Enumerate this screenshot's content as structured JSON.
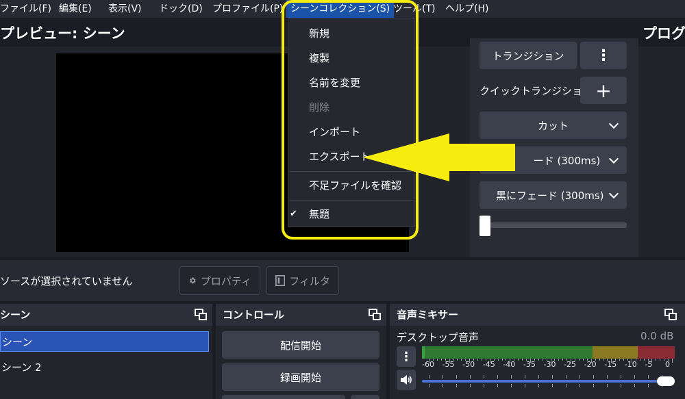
{
  "menubar": {
    "items": [
      {
        "label": "ファイル(F)"
      },
      {
        "label": "編集(E)"
      },
      {
        "label": "表示(V)"
      },
      {
        "label": "ドック(D)"
      },
      {
        "label": "プロファイル(P)"
      },
      {
        "label": "シーンコレクション(S)"
      },
      {
        "label": "ツール(T)"
      },
      {
        "label": "ヘルプ(H)"
      }
    ]
  },
  "preview": {
    "title": "プレビュー: シーン"
  },
  "program": {
    "title": "プログ"
  },
  "scene_collection_menu": {
    "items": [
      {
        "label": "新規"
      },
      {
        "label": "複製"
      },
      {
        "label": "名前を変更"
      },
      {
        "label": "削除",
        "disabled": true
      },
      {
        "label": "インポート"
      },
      {
        "label": "エクスポート"
      },
      {
        "label": "不足ファイルを確認"
      },
      {
        "label": "無題",
        "checked": true
      }
    ],
    "check_mark": "✔"
  },
  "transitions": {
    "transition_button": "トランジション",
    "more_glyph": "⋮",
    "quick_transition_label": "クイックトランジション",
    "add_glyph": "+",
    "cut": "カット",
    "fade": "フェード (300ms)",
    "fade_partial": "ード (300ms)",
    "fade_to_black": "黒にフェード (300ms)"
  },
  "source_bar": {
    "no_source": "ソースが選択されていません",
    "properties": "プロパティ",
    "filters": "フィルタ"
  },
  "scenes": {
    "title": "シーン",
    "items": [
      {
        "label": "シーン",
        "selected": true
      },
      {
        "label": "シーン 2"
      }
    ]
  },
  "controls": {
    "title": "コントロール",
    "start_streaming": "配信開始",
    "start_recording": "録画開始"
  },
  "mixer": {
    "title": "音声ミキサー",
    "channel_name": "デスクトップ音声",
    "level": "0.0 dB",
    "scale": [
      "-60",
      "-55",
      "-50",
      "-45",
      "-40",
      "-35",
      "-30",
      "-25",
      "-20",
      "-15",
      "-10",
      "-5",
      "0"
    ],
    "volume_fraction": 1.0
  },
  "colors": {
    "accent": "#1a53a8",
    "highlight": "#f7ec0f",
    "meter_green": "#3ca040",
    "meter_yellow": "#b59a28",
    "meter_red": "#b0303a"
  }
}
